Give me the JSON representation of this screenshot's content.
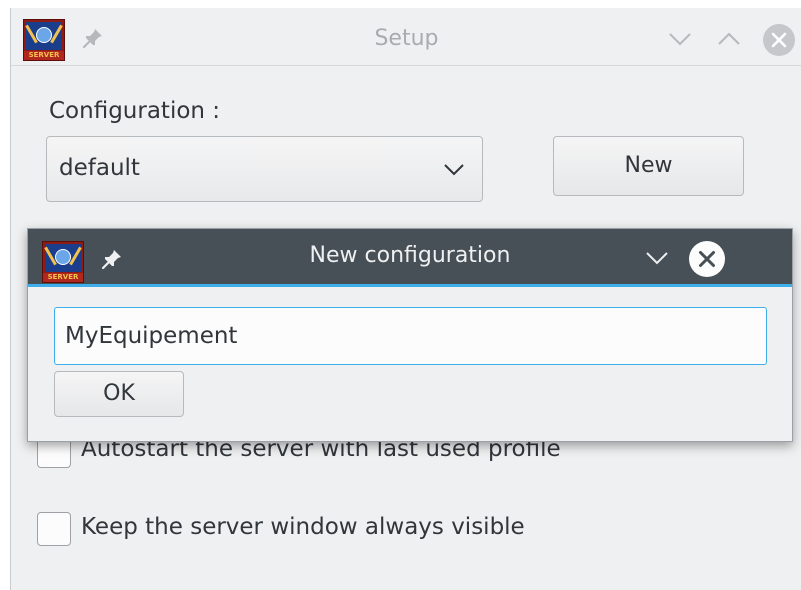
{
  "setup_window": {
    "title": "Setup",
    "icons": {
      "app": "app-logo-icon",
      "pin": "pin-icon",
      "minimize": "chevron-down-icon",
      "maximize": "chevron-up-icon",
      "close": "close-icon"
    },
    "configuration_label": "Configuration :",
    "configuration_selected": "default",
    "new_button_label": "New",
    "options": [
      {
        "label": "Autostart the server with last used profile",
        "checked": false
      },
      {
        "label": "Keep the server window always visible",
        "checked": false
      }
    ]
  },
  "dialog": {
    "title": "New configuration",
    "icons": {
      "app": "app-logo-icon",
      "pin": "pin-icon",
      "minimize": "chevron-down-icon",
      "close": "close-icon"
    },
    "name_value": "MyEquipement",
    "ok_label": "OK"
  },
  "logo_text": "SERVER",
  "colors": {
    "accent": "#3daee9",
    "dialog_titlebar": "#475057",
    "window_bg": "#eff0f1",
    "text": "#31363b"
  }
}
